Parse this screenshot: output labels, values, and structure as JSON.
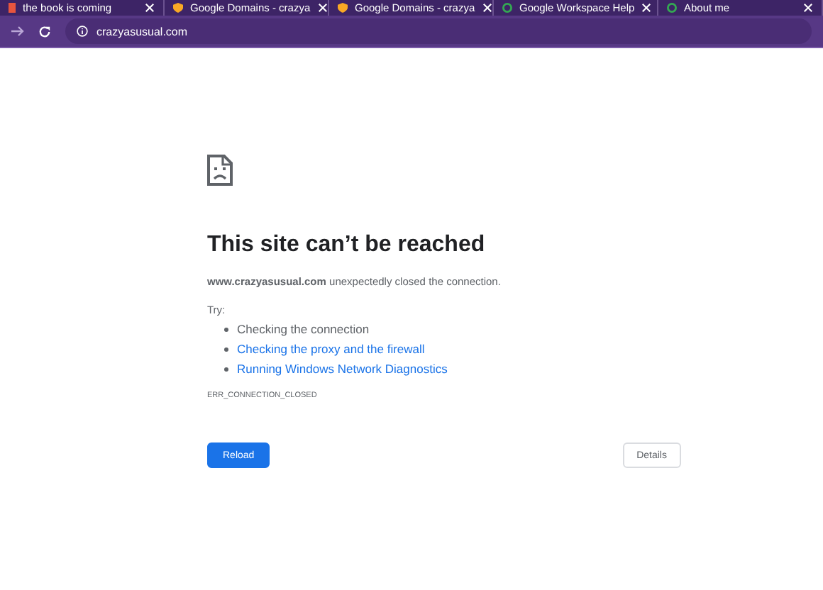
{
  "tabs": [
    {
      "title": "the book is coming",
      "selected": false
    },
    {
      "title": "Google Domains - crazya",
      "selected": false
    },
    {
      "title": "Google Domains - crazya",
      "selected": false
    },
    {
      "title": "Google Workspace Help",
      "selected": false
    },
    {
      "title": "About me",
      "selected": false
    }
  ],
  "toolbar": {
    "url": "crazyasusual.com"
  },
  "error": {
    "title": "This site can’t be reached",
    "message": "**www.crazyasusual.com** unexpectedly closed the connection.",
    "try_label": "Try:",
    "suggestions": [
      {
        "kind": "text",
        "text": "Checking the connection"
      },
      {
        "kind": "link",
        "text": "Checking the proxy and the firewall"
      },
      {
        "kind": "link",
        "text": "Running Windows Network Diagnostics"
      }
    ],
    "code": "ERR_CONNECTION_CLOSED"
  },
  "buttons": {
    "primary": "Reload",
    "secondary": "Details"
  }
}
